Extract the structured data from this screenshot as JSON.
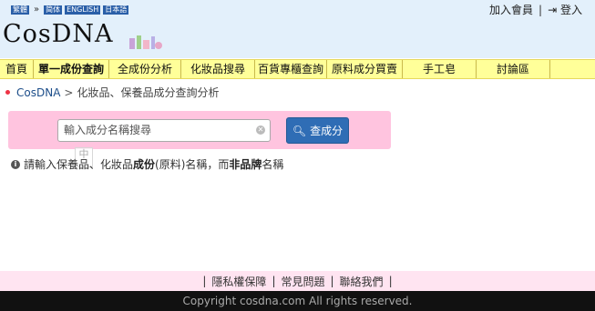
{
  "header": {
    "languages": [
      "繁體",
      "简体",
      "ENGLISH",
      "日本語"
    ],
    "lang_separator": "»",
    "register_label": "加入會員",
    "login_label": "登入",
    "logo_text": "CosDNA"
  },
  "nav": {
    "items": [
      {
        "label": "首頁",
        "active": false
      },
      {
        "label": "單一成份查詢",
        "active": true
      },
      {
        "label": "全成份分析",
        "active": false
      },
      {
        "label": "化妝品搜尋",
        "active": false
      },
      {
        "label": "百貨專櫃查詢",
        "active": false
      },
      {
        "label": "原料成分買賣",
        "active": false
      },
      {
        "label": "手工皂",
        "active": false
      },
      {
        "label": "討論區",
        "active": false
      }
    ]
  },
  "breadcrumb": {
    "root": "CosDNA",
    "separator": ">",
    "current": "化妝品、保養品成分查詢分析"
  },
  "search": {
    "placeholder": "輸入成分名稱搜尋",
    "value": "",
    "button_label": "查成分"
  },
  "hint": {
    "part1": "請輸入保養品、化妝品",
    "bold1": "成份",
    "part2": "(原料)名稱，而",
    "bold2": "非品牌",
    "part3": "名稱"
  },
  "faded_glyph": "中",
  "footer": {
    "links": [
      "隱私權保障",
      "常見問題",
      "聯絡我們"
    ],
    "separator": "|",
    "copyright": "Copyright cosdna.com All rights reserved."
  },
  "colors": {
    "topbar_bg": "#e3f0fb",
    "nav_bg": "#ffff99",
    "search_bg": "#ffc4df",
    "button_bg": "#2f6db5",
    "footer_bg": "#ffe4f1",
    "copyright_bg": "#111111"
  }
}
